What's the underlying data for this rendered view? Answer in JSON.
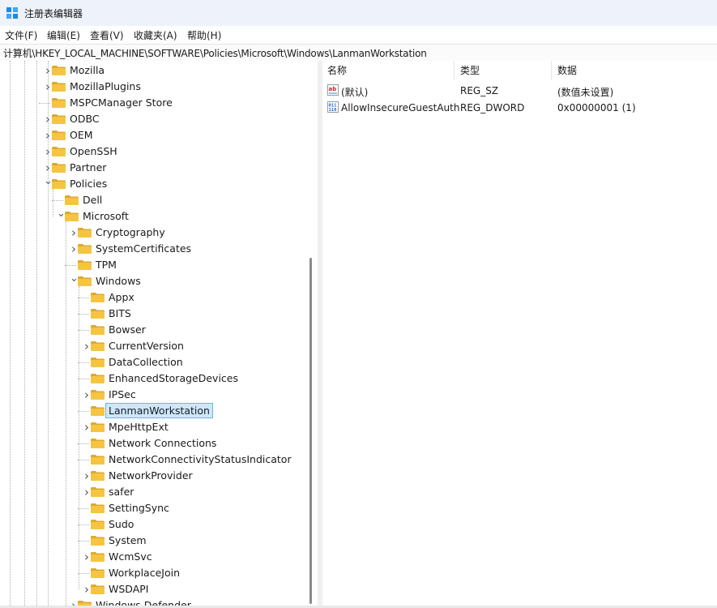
{
  "window": {
    "title": "注册表编辑器"
  },
  "menu": [
    "文件(F)",
    "编辑(E)",
    "查看(V)",
    "收藏夹(A)",
    "帮助(H)"
  ],
  "address": "计算机\\HKEY_LOCAL_MACHINE\\SOFTWARE\\Policies\\Microsoft\\Windows\\LanmanWorkstation",
  "tree": [
    {
      "label": "Mozilla",
      "level": 0,
      "expander": "collapsed"
    },
    {
      "label": "MozillaPlugins",
      "level": 0,
      "expander": "collapsed"
    },
    {
      "label": "MSPCManager Store",
      "level": 0,
      "expander": "none"
    },
    {
      "label": "ODBC",
      "level": 0,
      "expander": "collapsed"
    },
    {
      "label": "OEM",
      "level": 0,
      "expander": "collapsed"
    },
    {
      "label": "OpenSSH",
      "level": 0,
      "expander": "collapsed"
    },
    {
      "label": "Partner",
      "level": 0,
      "expander": "collapsed"
    },
    {
      "label": "Policies",
      "level": 0,
      "expander": "expanded"
    },
    {
      "label": "Dell",
      "level": 1,
      "expander": "none"
    },
    {
      "label": "Microsoft",
      "level": 1,
      "expander": "expanded"
    },
    {
      "label": "Cryptography",
      "level": 2,
      "expander": "collapsed"
    },
    {
      "label": "SystemCertificates",
      "level": 2,
      "expander": "collapsed"
    },
    {
      "label": "TPM",
      "level": 2,
      "expander": "none"
    },
    {
      "label": "Windows",
      "level": 2,
      "expander": "expanded"
    },
    {
      "label": "Appx",
      "level": 3,
      "expander": "none"
    },
    {
      "label": "BITS",
      "level": 3,
      "expander": "none"
    },
    {
      "label": "Bowser",
      "level": 3,
      "expander": "none"
    },
    {
      "label": "CurrentVersion",
      "level": 3,
      "expander": "collapsed"
    },
    {
      "label": "DataCollection",
      "level": 3,
      "expander": "none"
    },
    {
      "label": "EnhancedStorageDevices",
      "level": 3,
      "expander": "none"
    },
    {
      "label": "IPSec",
      "level": 3,
      "expander": "collapsed"
    },
    {
      "label": "LanmanWorkstation",
      "level": 3,
      "expander": "none",
      "selected": true
    },
    {
      "label": "MpeHttpExt",
      "level": 3,
      "expander": "collapsed"
    },
    {
      "label": "Network Connections",
      "level": 3,
      "expander": "none"
    },
    {
      "label": "NetworkConnectivityStatusIndicator",
      "level": 3,
      "expander": "none"
    },
    {
      "label": "NetworkProvider",
      "level": 3,
      "expander": "collapsed"
    },
    {
      "label": "safer",
      "level": 3,
      "expander": "collapsed"
    },
    {
      "label": "SettingSync",
      "level": 3,
      "expander": "none"
    },
    {
      "label": "Sudo",
      "level": 3,
      "expander": "none"
    },
    {
      "label": "System",
      "level": 3,
      "expander": "none"
    },
    {
      "label": "WcmSvc",
      "level": 3,
      "expander": "collapsed"
    },
    {
      "label": "WorkplaceJoin",
      "level": 3,
      "expander": "none"
    },
    {
      "label": "WSDAPI",
      "level": 3,
      "expander": "collapsed"
    },
    {
      "label": "Windows Defender",
      "level": 2,
      "expander": "collapsed"
    }
  ],
  "list": {
    "headers": [
      "名称",
      "类型",
      "数据"
    ],
    "rows": [
      {
        "name": "(默认)",
        "type": "REG_SZ",
        "data": "(数值未设置)",
        "icon": "string-value-icon"
      },
      {
        "name": "AllowInsecureGuestAuth",
        "type": "REG_DWORD",
        "data": "0x00000001 (1)",
        "icon": "binary-value-icon"
      }
    ]
  },
  "colors": {
    "folder": "#f5c542",
    "folder_dark": "#e0a82e",
    "selection": "#cce8ff",
    "titlebar": "#eef2fa"
  }
}
